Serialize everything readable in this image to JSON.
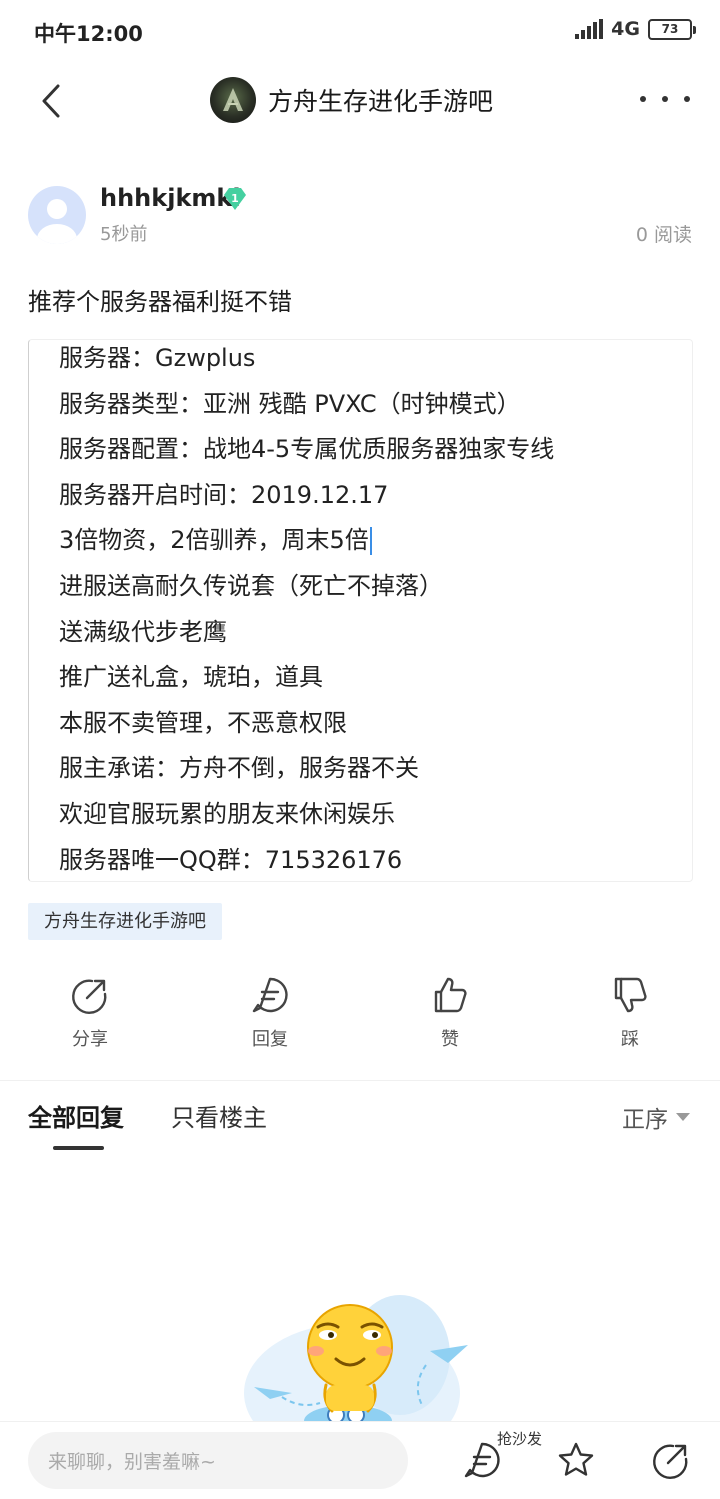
{
  "status_bar": {
    "time": "中午12:00",
    "network": "4G",
    "battery": "73"
  },
  "nav": {
    "title": "方舟生存进化手游吧"
  },
  "post": {
    "username": "hhhkjkmkl",
    "level": "1",
    "time_ago": "5秒前",
    "read_count": "0 阅读",
    "title": "推荐个服务器福利挺不错",
    "lines": [
      "服务器：Gzwplus",
      "服务器类型：亚洲 残酷 PVXC（时钟模式）",
      "服务器配置：战地4-5专属优质服务器独家专线",
      "服务器开启时间：2019.12.17",
      "3倍物资，2倍驯养，周末5倍",
      "进服送高耐久传说套（死亡不掉落）",
      "送满级代步老鹰",
      "推广送礼盒，琥珀，道具",
      "本服不卖管理，不恶意权限",
      "服主承诺：方舟不倒，服务器不关",
      "欢迎官服玩累的朋友来休闲娱乐",
      "服务器唯一QQ群：715326176"
    ],
    "forum_tag": "方舟生存进化手游吧"
  },
  "actions": {
    "share": "分享",
    "reply": "回复",
    "like": "赞",
    "dislike": "踩"
  },
  "reply_tabs": {
    "all": "全部回复",
    "op_only": "只看楼主",
    "sort": "正序"
  },
  "bottom_bar": {
    "placeholder": "来聊聊，别害羞嘛~",
    "sofa": "抢沙发"
  },
  "colors": {
    "accent_blue": "#3a8ee6",
    "badge_green": "#45d0a0",
    "tag_bg": "#e8f1fb"
  }
}
